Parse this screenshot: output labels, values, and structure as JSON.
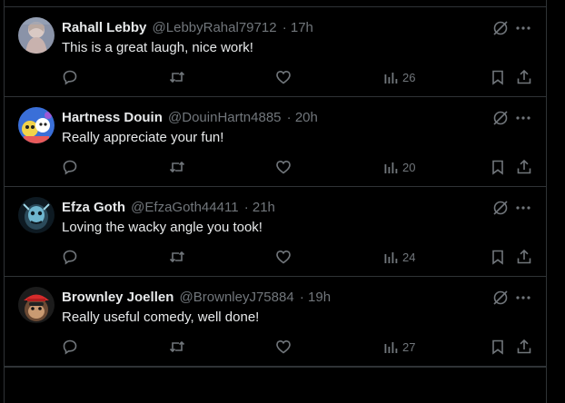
{
  "theme": {
    "background": "#000000",
    "text_primary": "#e7e9ea",
    "text_secondary": "#71767b",
    "divider": "#2f3336"
  },
  "tweets": [
    {
      "display_name": "Rahall Lebby",
      "handle": "@LebbyRahal79712",
      "time": "· 17h",
      "text": "This is a great laugh, nice work!",
      "views": "26",
      "avatar": "avatar-pale-figure"
    },
    {
      "display_name": "Hartness Douin",
      "handle": "@DouinHartn4885",
      "time": "· 20h",
      "text": "Really appreciate your fun!",
      "views": "20",
      "avatar": "avatar-cartoon-characters"
    },
    {
      "display_name": "Efza Goth",
      "handle": "@EfzaGoth44411",
      "time": "· 21h",
      "text": "Loving the wacky angle you took!",
      "views": "24",
      "avatar": "avatar-dark-creature"
    },
    {
      "display_name": "Brownley Joellen",
      "handle": "@BrownleyJ75884",
      "time": "· 19h",
      "text": "Really useful comedy, well done!",
      "views": "27",
      "avatar": "avatar-monkey-red-cap"
    }
  ],
  "icons": {
    "reply": "reply-icon",
    "repost": "repost-icon",
    "like": "heart-icon",
    "views": "views-chart-icon",
    "bookmark": "bookmark-icon",
    "share": "share-icon",
    "grok": "grok-icon",
    "more": "more-icon"
  }
}
